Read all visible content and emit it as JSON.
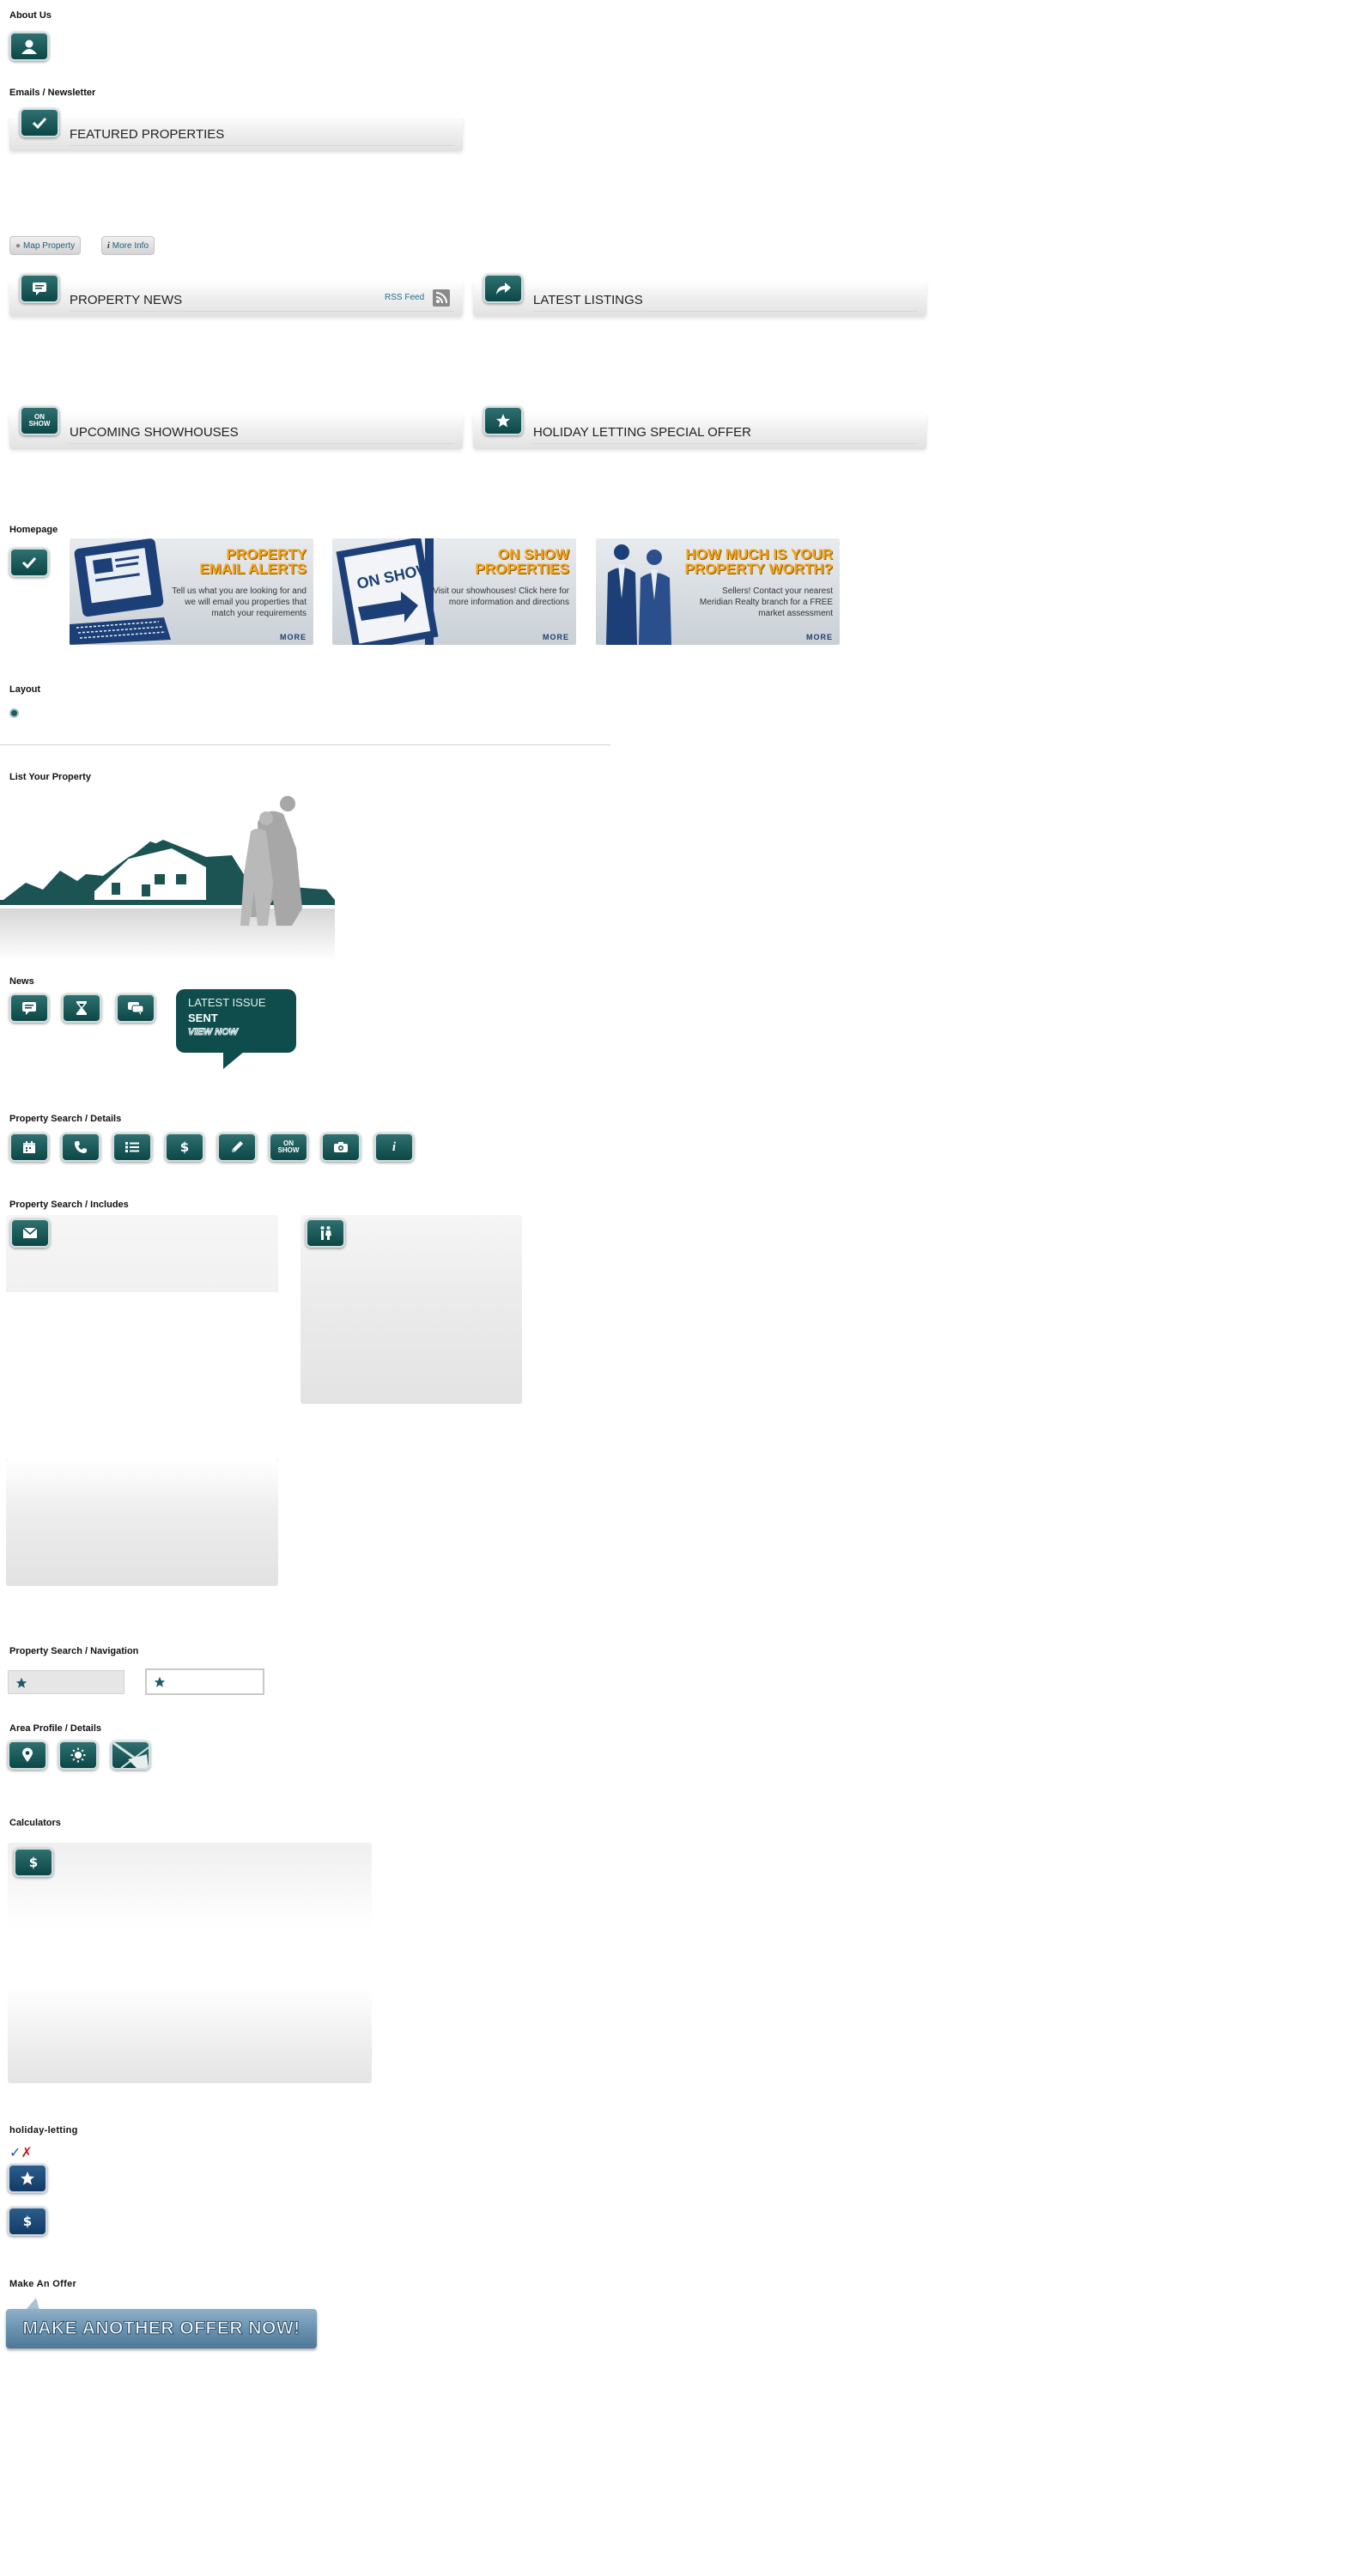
{
  "sections": {
    "about": "About Us",
    "emails": "Emails / Newsletter",
    "homepage": "Homepage",
    "layout": "Layout",
    "list_property": "List Your Property",
    "news": "News",
    "search_details": "Property Search / Details",
    "search_includes": "Property Search / Includes",
    "search_nav": "Property Search / Navigation",
    "area": "Area Profile / Details",
    "calculators": "Calculators",
    "holiday": "holiday-letting",
    "offer": "Make An Offer"
  },
  "bars": {
    "featured": "FEATURED PROPERTIES",
    "news": "PROPERTY NEWS",
    "rss": "RSS Feed",
    "latest": "LATEST LISTINGS",
    "showhouses": "UPCOMING SHOWHOUSES",
    "holiday": "HOLIDAY LETTING SPECIAL OFFER"
  },
  "pills": {
    "map": "Map Property",
    "info": "More Info"
  },
  "onshow": {
    "line1": "ON",
    "line2": "SHOW"
  },
  "promos": [
    {
      "title1": "PROPERTY",
      "title2": "EMAIL ALERTS",
      "desc": "Tell us what you are looking for and we will email you properties that match your requirements",
      "more": "MORE"
    },
    {
      "title1": "ON SHOW",
      "title2": "PROPERTIES",
      "desc": "Visit our showhouses! Click here for more information and directions",
      "more": "MORE",
      "sign": "ON SHOW"
    },
    {
      "title1": "HOW MUCH IS YOUR",
      "title2": "PROPERTY WORTH?",
      "desc": "Sellers! Contact your nearest Meridian Realty branch for a FREE market assessment",
      "more": "MORE"
    }
  ],
  "newsletter": {
    "line1": "LATEST ISSUE",
    "line2": "SENT",
    "line3": "VIEW NOW"
  },
  "holiday_marks": {
    "check": "✓",
    "cross": "✗"
  },
  "offer_button": "MAKE ANOTHER OFFER NOW!",
  "colors": {
    "teal": "#0c4747",
    "navy": "#123b66",
    "accent_orange": "#f4a41c",
    "offer_blue": "#5f8aa8"
  }
}
